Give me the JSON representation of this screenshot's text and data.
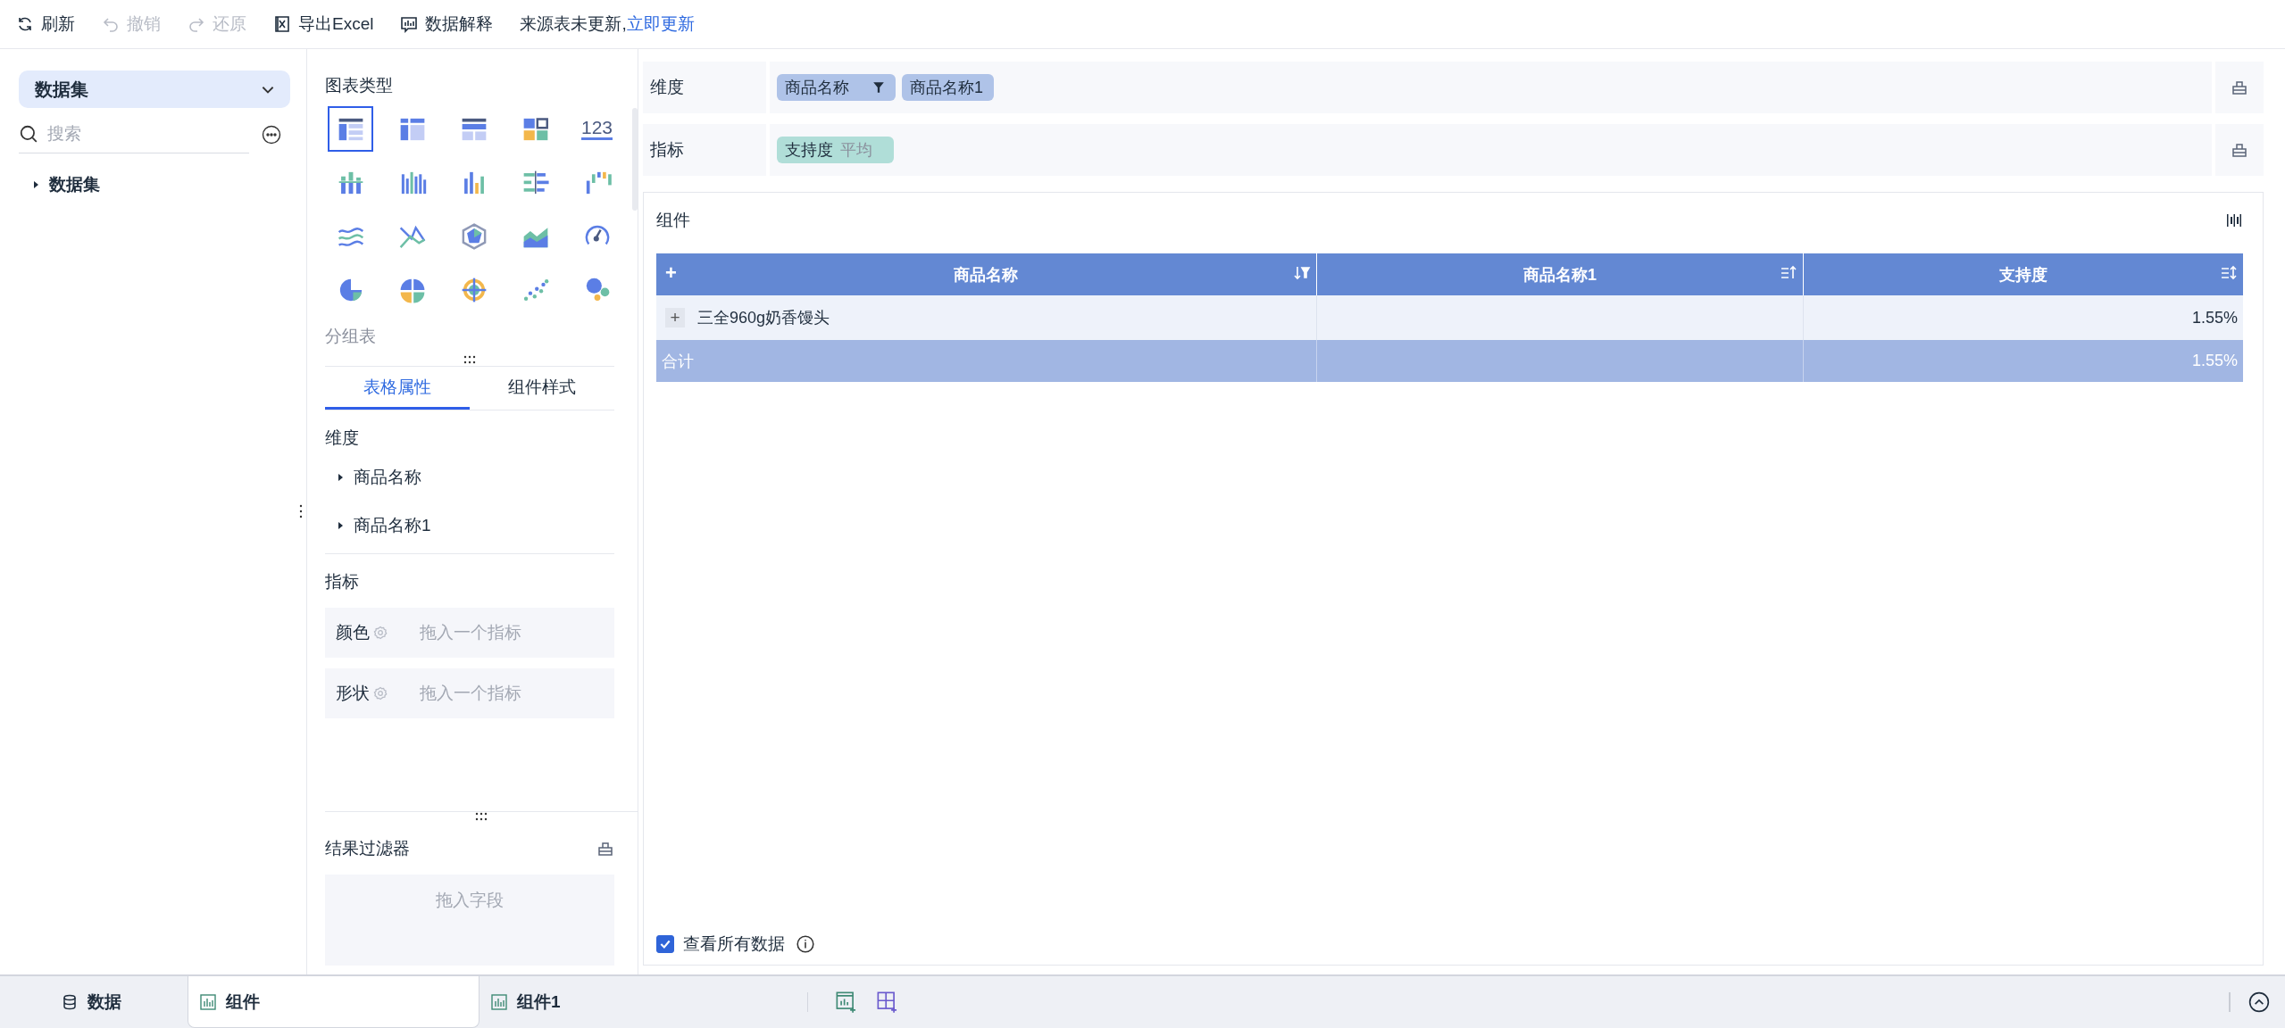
{
  "toolbar": {
    "actions": [
      {
        "kind": "refresh",
        "label": "刷新",
        "disabled": false
      },
      {
        "kind": "undo",
        "label": "撤销",
        "disabled": true
      },
      {
        "kind": "redo",
        "label": "还原",
        "disabled": true
      },
      {
        "kind": "excel",
        "label": "导出Excel",
        "disabled": false
      },
      {
        "kind": "explain",
        "label": "数据解释",
        "disabled": false
      }
    ],
    "notice": {
      "text": "来源表未更新,",
      "link": "立即更新"
    }
  },
  "data_panel": {
    "dropdown": "数据集",
    "search": {
      "placeholder": "搜索"
    },
    "tree": [
      {
        "label": "数据集",
        "expanded": false
      }
    ]
  },
  "chart_panel": {
    "title": "图表类型",
    "types": [
      {
        "kind": "grouptable",
        "selected": true
      },
      {
        "kind": "crosstable",
        "selected": false
      },
      {
        "kind": "detailtable",
        "selected": false
      },
      {
        "kind": "tiles",
        "selected": false
      },
      {
        "kind": "number",
        "text": "123",
        "selected": false
      },
      {
        "kind": "stacked",
        "selected": false
      },
      {
        "kind": "multibar",
        "selected": false
      },
      {
        "kind": "bar",
        "selected": false
      },
      {
        "kind": "hbar",
        "selected": false
      },
      {
        "kind": "waterfall",
        "selected": false
      },
      {
        "kind": "wave",
        "selected": false
      },
      {
        "kind": "lines",
        "selected": false
      },
      {
        "kind": "radar",
        "selected": false
      },
      {
        "kind": "area",
        "selected": false
      },
      {
        "kind": "gauge",
        "selected": false
      },
      {
        "kind": "pie",
        "selected": false
      },
      {
        "kind": "quarters",
        "selected": false
      },
      {
        "kind": "target",
        "selected": false
      },
      {
        "kind": "scatter",
        "selected": false
      },
      {
        "kind": "bubble",
        "selected": false
      }
    ],
    "type_name": "分组表",
    "tabs": [
      {
        "label": "表格属性",
        "selected": true
      },
      {
        "label": "组件样式",
        "selected": false
      }
    ],
    "dimension": {
      "title": "维度",
      "items": [
        {
          "label": "商品名称",
          "expanded": false
        },
        {
          "label": "商品名称1",
          "expanded": false
        }
      ]
    },
    "measure": {
      "title": "指标",
      "slots": [
        {
          "label": "颜色",
          "hint": "拖入一个指标"
        },
        {
          "label": "形状",
          "hint": "拖入一个指标"
        }
      ]
    },
    "result_filter": {
      "title": "结果过滤器",
      "hint": "拖入字段"
    }
  },
  "fields": {
    "dimension": {
      "label": "维度",
      "pills": [
        {
          "label": "商品名称",
          "filtered": true
        },
        {
          "label": "商品名称1",
          "filtered": false
        }
      ]
    },
    "measure": {
      "label": "指标",
      "pills": [
        {
          "label": "支持度",
          "aggregation": "平均"
        }
      ]
    }
  },
  "widget": {
    "title": "组件",
    "table": {
      "expand": "+",
      "columns": [
        {
          "label": "商品名称",
          "kind": "sortfilter"
        },
        {
          "label": "商品名称1",
          "kind": "asc"
        },
        {
          "label": "支持度",
          "kind": "sort"
        }
      ],
      "rows": [
        {
          "expand": "+",
          "name": "三全960g奶香馒头",
          "value": "1.55%"
        }
      ],
      "total": {
        "label": "合计",
        "value": "1.55%"
      }
    },
    "show_all": {
      "label": "查看所有数据",
      "checked": true
    }
  },
  "bottom_tabs": [
    {
      "kind": "data",
      "label": "数据",
      "selected": false
    },
    {
      "kind": "widget",
      "label": "组件",
      "selected": true
    },
    {
      "kind": "widget",
      "label": "组件1",
      "selected": false
    }
  ]
}
